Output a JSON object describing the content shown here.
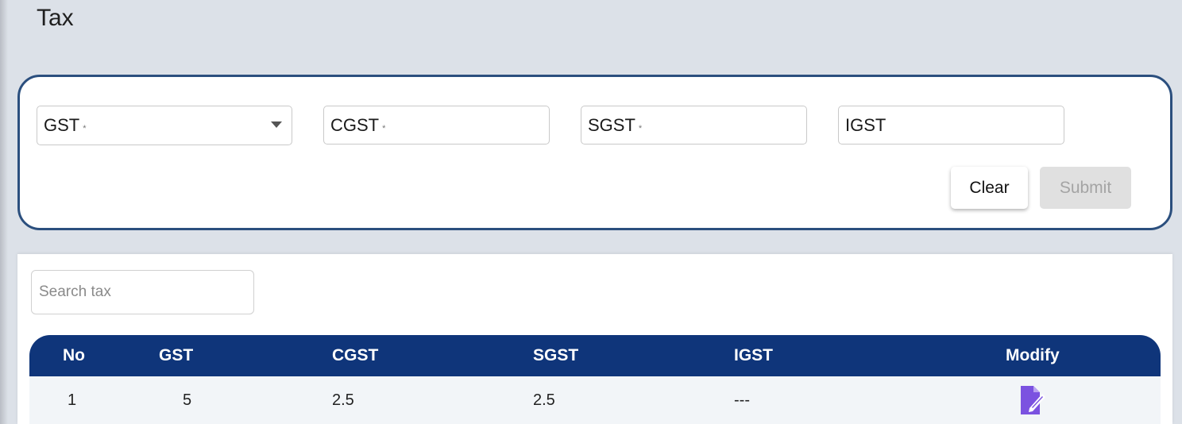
{
  "page": {
    "title": "Tax"
  },
  "form": {
    "fields": {
      "gst": {
        "label": "GST",
        "required_mark": "*"
      },
      "cgst": {
        "label": "CGST",
        "required_mark": "*"
      },
      "sgst": {
        "label": "SGST",
        "required_mark": "*"
      },
      "igst": {
        "label": "IGST"
      }
    },
    "buttons": {
      "clear": "Clear",
      "submit": "Submit"
    }
  },
  "search": {
    "placeholder": "Search tax"
  },
  "table": {
    "headers": {
      "no": "No",
      "gst": "GST",
      "cgst": "CGST",
      "sgst": "SGST",
      "igst": "IGST",
      "modify": "Modify"
    },
    "rows": [
      {
        "no": "1",
        "gst": "5",
        "cgst": "2.5",
        "sgst": "2.5",
        "igst": "---",
        "modify_icon": "edit-icon"
      }
    ]
  },
  "colors": {
    "page_bg": "#dce1e8",
    "form_border": "#2b4f7e",
    "table_header_bg": "#0f357a",
    "edit_icon": "#7b52e0",
    "submit_disabled_bg": "#e0e0e0"
  }
}
